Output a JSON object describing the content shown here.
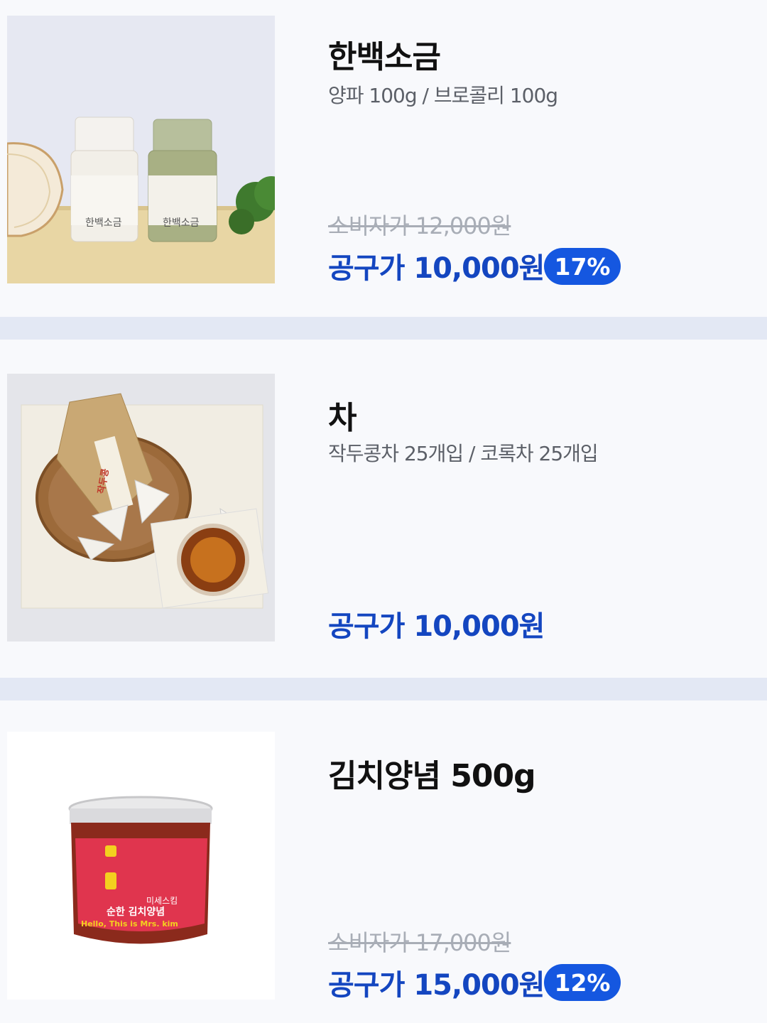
{
  "products": [
    {
      "name": "한백소금",
      "options": "양파 100g / 브로콜리 100g",
      "consumer_price": "소비자가 12,000원",
      "group_price": "공구가 10,000원",
      "discount": "17%",
      "image": {
        "jar_label_1": "한백소금",
        "jar_label_2": "한백소금"
      }
    },
    {
      "name": "차",
      "options": "작두콩차 25개입 / 코록차 25개입",
      "group_price": "공구가 10,000원",
      "image": {
        "pouch_label": "작두콩"
      }
    },
    {
      "name": "김치양념 500g",
      "consumer_price": "소비자가 17,000원",
      "group_price": "공구가 15,000원",
      "discount": "12%",
      "image": {
        "label_line1": "미세스킴",
        "label_line2": "순한 김치양념",
        "label_line3": "Hello, This is Mrs. kim"
      }
    }
  ],
  "colors": {
    "accent": "#1446c0",
    "badge": "#1557e0",
    "divider": "#e3e8f4",
    "muted": "#a8adb6"
  }
}
